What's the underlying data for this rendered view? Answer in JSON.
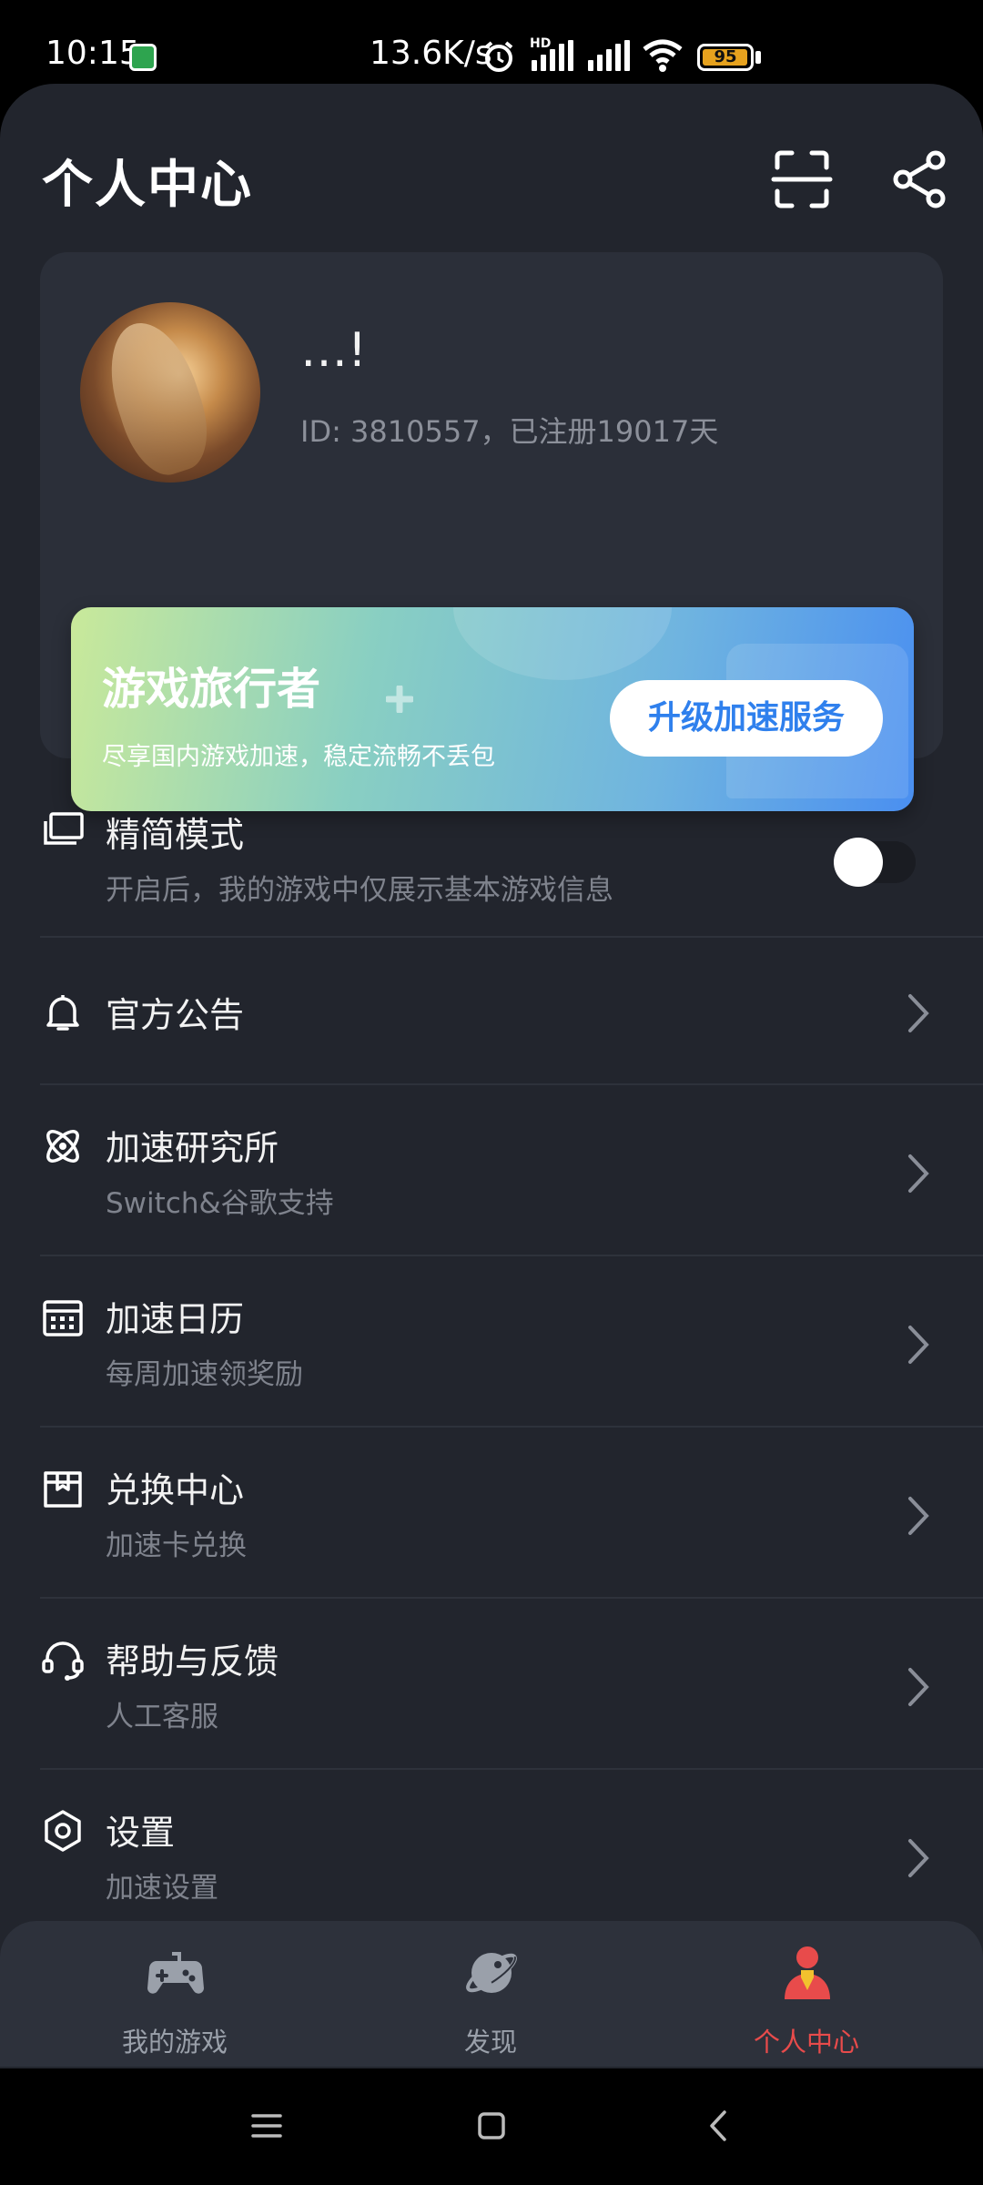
{
  "status_bar": {
    "time": "10:15",
    "network_speed": "13.6K/s",
    "hd_badge": "HD",
    "battery_level": "95",
    "battery_percent": 95,
    "icons": [
      "shield-icon",
      "alarm-icon",
      "signal-icon",
      "signal-icon",
      "wifi-icon",
      "battery-icon"
    ]
  },
  "header": {
    "title": "个人中心",
    "scan_icon": "scan-icon",
    "share_icon": "share-icon"
  },
  "profile": {
    "nickname": "…!",
    "user_info": "ID: 3810557，已注册19017天"
  },
  "vip": {
    "title": "游戏旅行者",
    "subtitle": "尽享国内游戏加速，稳定流畅不丢包",
    "button": "升级加速服务",
    "colors": {
      "start": "#c9e99a",
      "end": "#4a8ff0",
      "button_text": "#2f80ed"
    }
  },
  "menu": [
    {
      "id": "simple-mode",
      "icon": "layers-icon",
      "label": "精简模式",
      "sub": "开启后，我的游戏中仅展示基本游戏信息",
      "toggle": false
    },
    {
      "id": "announcements",
      "icon": "bell-icon",
      "label": "官方公告",
      "sub": ""
    },
    {
      "id": "lab",
      "icon": "atom-icon",
      "label": "加速研究所",
      "sub": "Switch&谷歌支持"
    },
    {
      "id": "calendar",
      "icon": "calendar-icon",
      "label": "加速日历",
      "sub": "每周加速领奖励"
    },
    {
      "id": "exchange",
      "icon": "gift-box-icon",
      "label": "兑换中心",
      "sub": "加速卡兑换"
    },
    {
      "id": "help",
      "icon": "headset-icon",
      "label": "帮助与反馈",
      "sub": "人工客服"
    },
    {
      "id": "settings",
      "icon": "hexagon-gear-icon",
      "label": "设置",
      "sub": "加速设置"
    }
  ],
  "tabs": [
    {
      "label": "我的游戏",
      "icon": "gamepad-icon",
      "active": false
    },
    {
      "label": "发现",
      "icon": "planet-icon",
      "active": false
    },
    {
      "label": "个人中心",
      "icon": "person-icon",
      "active": true
    }
  ],
  "accent_color": "#e84b4b"
}
